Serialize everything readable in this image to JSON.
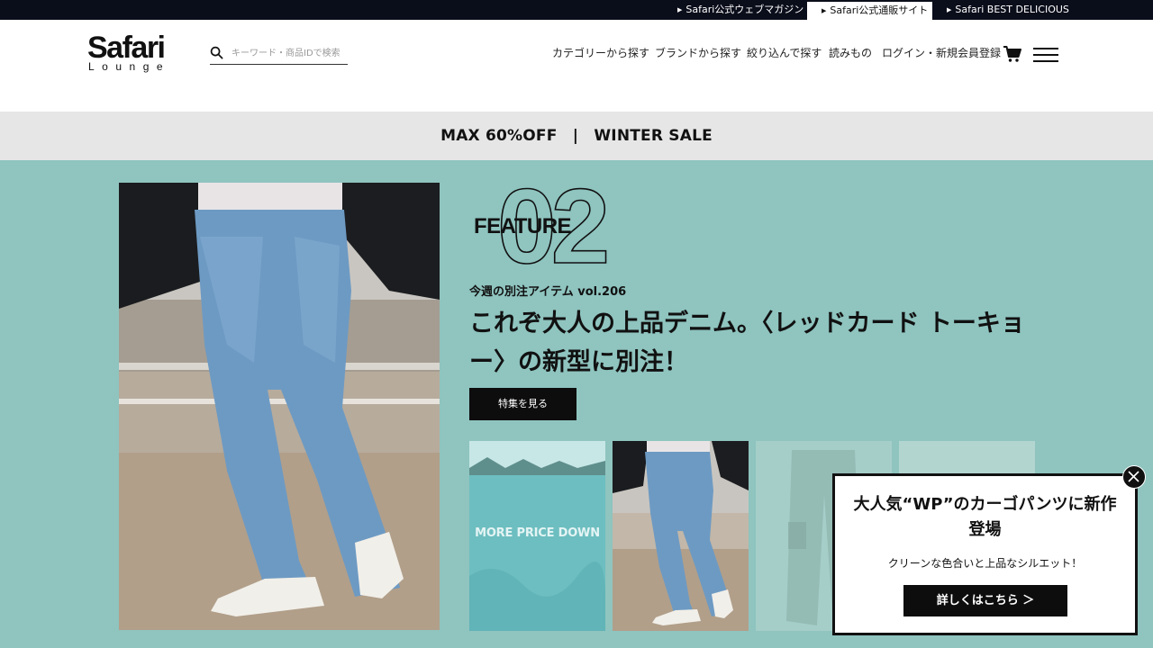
{
  "topbar": {
    "links": [
      {
        "label": "Safari公式ウェブマガジン"
      },
      {
        "label": "Safari公式通販サイト",
        "active": true
      },
      {
        "label": "Safari BEST DELICIOUS"
      }
    ]
  },
  "header": {
    "logo_main": "Safari",
    "logo_sub": "Lounge",
    "search_placeholder": "キーワード・商品IDで検索",
    "search_icon": "search-icon",
    "nav": [
      {
        "label": "カテゴリーから探す"
      },
      {
        "label": "ブランドから探す"
      },
      {
        "label": "絞り込んで探す"
      },
      {
        "label": "読みもの"
      },
      {
        "label": "ログイン・新規会員登録"
      }
    ],
    "cart_icon": "cart-icon",
    "menu_icon": "hamburger-menu-icon"
  },
  "sale_banner": {
    "text": "MAX 60%OFF　|　WINTER SALE"
  },
  "feature": {
    "label": "FEATURE",
    "number": "02",
    "subtitle": "今週の別注アイテム vol.206",
    "title": "これぞ大人の上品デニム。〈レッドカード トーキョー〉の新型に別注！",
    "button": "特集を見る",
    "thumbnails": [
      {
        "caption": "MORE PRICE DOWN"
      },
      {
        "caption": ""
      },
      {
        "caption": ""
      },
      {
        "caption": ""
      }
    ]
  },
  "popup": {
    "title": "大人気“WP”のカーゴパンツに新作登場",
    "text": "クリーンな色合いと上品なシルエット！",
    "button": "詳しくはこちら ＞",
    "close_icon": "close-icon"
  },
  "colors": {
    "topbar_bg": "#0a0d1a",
    "sale_bg": "#e6e6e6",
    "feature_bg": "#8fc4bf",
    "button_bg": "#0d0d0d"
  }
}
